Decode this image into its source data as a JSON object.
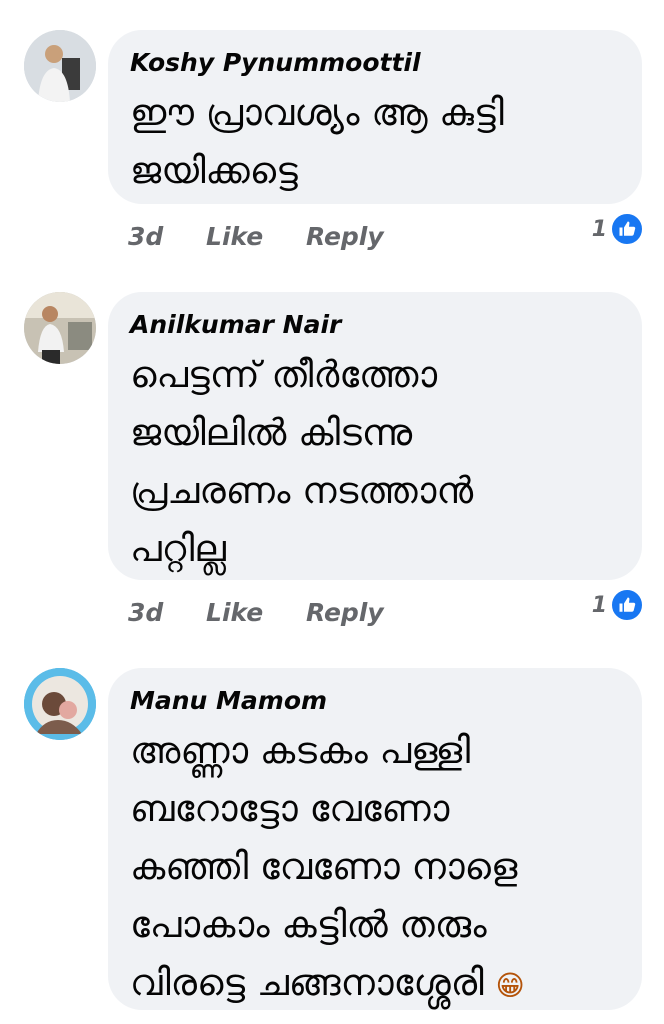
{
  "comments": [
    {
      "author": "Koshy Pynummoottil",
      "text": "ഈ പ്രാവശ്യം ആ കുട്ടി\nജയിക്കട്ടെ",
      "time": "3d",
      "like_label": "Like",
      "reply_label": "Reply",
      "reaction_count": "1"
    },
    {
      "author": "Anilkumar Nair",
      "text": "പെട്ടന്ന് തീർത്തോ\nജയിലിൽ കിടന്നു\nപ്രചരണം നടത്താൻ\nപറ്റില്ല",
      "time": "3d",
      "like_label": "Like",
      "reply_label": "Reply",
      "reaction_count": "1"
    },
    {
      "author": "Manu Mamom",
      "text": "അണ്ണാ കടകം പള്ളി\nബറോട്ടോ വേണോ\nകഞ്ഞി വേണോ നാളെ\nപോകാം  കട്ടിൽ തരും\nവിരട്ടെ ചങ്ങനാശ്ശേരി",
      "emoji": "😁"
    }
  ],
  "colors": {
    "bubble": "#f0f2f5",
    "meta": "#65676b",
    "like_badge": "#1877f2"
  }
}
